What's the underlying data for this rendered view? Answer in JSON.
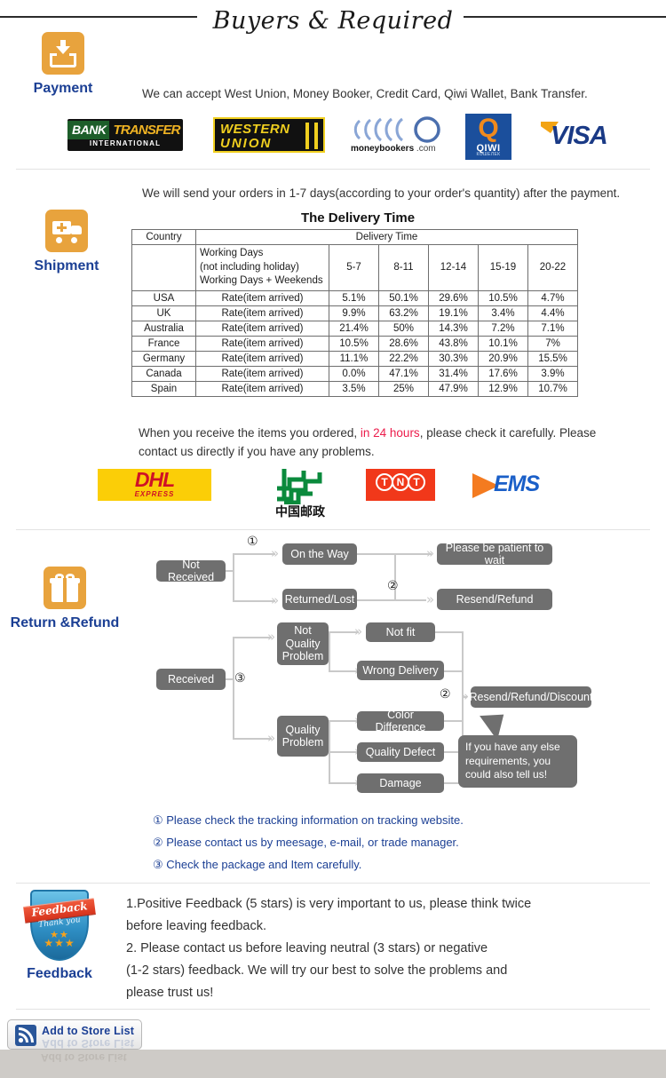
{
  "header": {
    "title": "Buyers & Required"
  },
  "payment": {
    "label": "Payment",
    "icon": "inbox-download-icon",
    "text": "We can accept West Union, Money Booker, Credit Card, Qiwi Wallet, Bank Transfer.",
    "logos": [
      {
        "name": "bank-transfer",
        "line1a": "BANK",
        "line1b": "TRANSFER",
        "line2": "INTERNATIONAL"
      },
      {
        "name": "western-union",
        "line1": "WESTERN",
        "line2": "UNION"
      },
      {
        "name": "moneybookers",
        "caption_bold": "moneybookers",
        "caption_light": " .com"
      },
      {
        "name": "qiwi",
        "mark": "Q",
        "title": "QIWI",
        "sub": "КОШЕЛЕК"
      },
      {
        "name": "visa",
        "text": "VISA"
      }
    ]
  },
  "shipment": {
    "label": "Shipment",
    "icon": "delivery-truck-icon",
    "intro": "We will send your orders in 1-7 days(according to your order's quantity) after the payment.",
    "table_title": "The Delivery Time",
    "table": {
      "col_country": "Country",
      "col_delivery": "Delivery Time",
      "working_days": [
        "Working Days",
        "(not including holiday)",
        "Working Days + Weekends"
      ],
      "ranges": [
        "5-7",
        "8-11",
        "12-14",
        "15-19",
        "20-22"
      ],
      "rate_label": "Rate(item arrived)",
      "rows": [
        {
          "country": "USA",
          "values": [
            "5.1%",
            "50.1%",
            "29.6%",
            "10.5%",
            "4.7%"
          ]
        },
        {
          "country": "UK",
          "values": [
            "9.9%",
            "63.2%",
            "19.1%",
            "3.4%",
            "4.4%"
          ]
        },
        {
          "country": "Australia",
          "values": [
            "21.4%",
            "50%",
            "14.3%",
            "7.2%",
            "7.1%"
          ]
        },
        {
          "country": "France",
          "values": [
            "10.5%",
            "28.6%",
            "43.8%",
            "10.1%",
            "7%"
          ]
        },
        {
          "country": "Germany",
          "values": [
            "11.1%",
            "22.2%",
            "30.3%",
            "20.9%",
            "15.5%"
          ]
        },
        {
          "country": "Canada",
          "values": [
            "0.0%",
            "47.1%",
            "31.4%",
            "17.6%",
            "3.9%"
          ]
        },
        {
          "country": "Spain",
          "values": [
            "3.5%",
            "25%",
            "47.9%",
            "12.9%",
            "10.7%"
          ]
        }
      ]
    },
    "notice_before": "When you receive the items you ordered, ",
    "notice_highlight": "in 24 hours",
    "notice_after": ", please check it carefully. Please",
    "notice_line2": "contact us directly if you have any problems.",
    "carriers": [
      {
        "name": "dhl",
        "text": "DHL",
        "sub": "EXPRESS"
      },
      {
        "name": "china-post",
        "text": "中国邮政"
      },
      {
        "name": "tnt",
        "letters": [
          "T",
          "N",
          "T"
        ]
      },
      {
        "name": "ems",
        "text": "EMS"
      }
    ]
  },
  "returns": {
    "label": "Return &Refund",
    "icon": "gift-box-icon",
    "nodes": {
      "not_received": "Not Received",
      "on_the_way": "On the Way",
      "returned_lost": "Returned/Lost",
      "please_wait": "Please be patient to wait",
      "resend_refund": "Resend/Refund",
      "received": "Received",
      "not_quality": "Not\nQuality\nProblem",
      "not_quality_l1": "Not",
      "not_quality_l2": "Quality",
      "not_quality_l3": "Problem",
      "quality_l1": "Quality",
      "quality_l2": "Problem",
      "not_fit": "Not fit",
      "wrong_delivery": "Wrong Delivery",
      "color_difference": "Color Difference",
      "quality_defect": "Quality Defect",
      "damage": "Damage",
      "resend_refund_discount": "Resend/Refund/Discount"
    },
    "bubble": "If you have any else requirements, you could also tell us!",
    "markers": {
      "one": "①",
      "two": "②",
      "three": "③"
    },
    "notes": [
      "① Please check the tracking information on tracking website.",
      "② Please contact us by meesage, e-mail, or trade manager.",
      "③ Check the package and Item carefully."
    ]
  },
  "feedback": {
    "label": "Feedback",
    "badge_title": "Feedback",
    "badge_sub": "Thank you",
    "stars": "★★★",
    "stars_top": "★★",
    "lines": [
      "1.Positive Feedback (5 stars) is very important to us, please think twice",
      " before leaving feedback.",
      "2. Please contact us before leaving neutral (3 stars) or negative",
      "(1-2 stars) feedback. We will try our best to solve the problems and",
      " please trust us!"
    ]
  },
  "store_button": {
    "label": "Add to Store List",
    "icon": "rss-feed-icon"
  },
  "colors": {
    "accent_orange": "#e8a33d",
    "label_blue": "#1b3f94",
    "highlight_red": "#ec1c4b",
    "node_gray": "#6f6f6f"
  }
}
